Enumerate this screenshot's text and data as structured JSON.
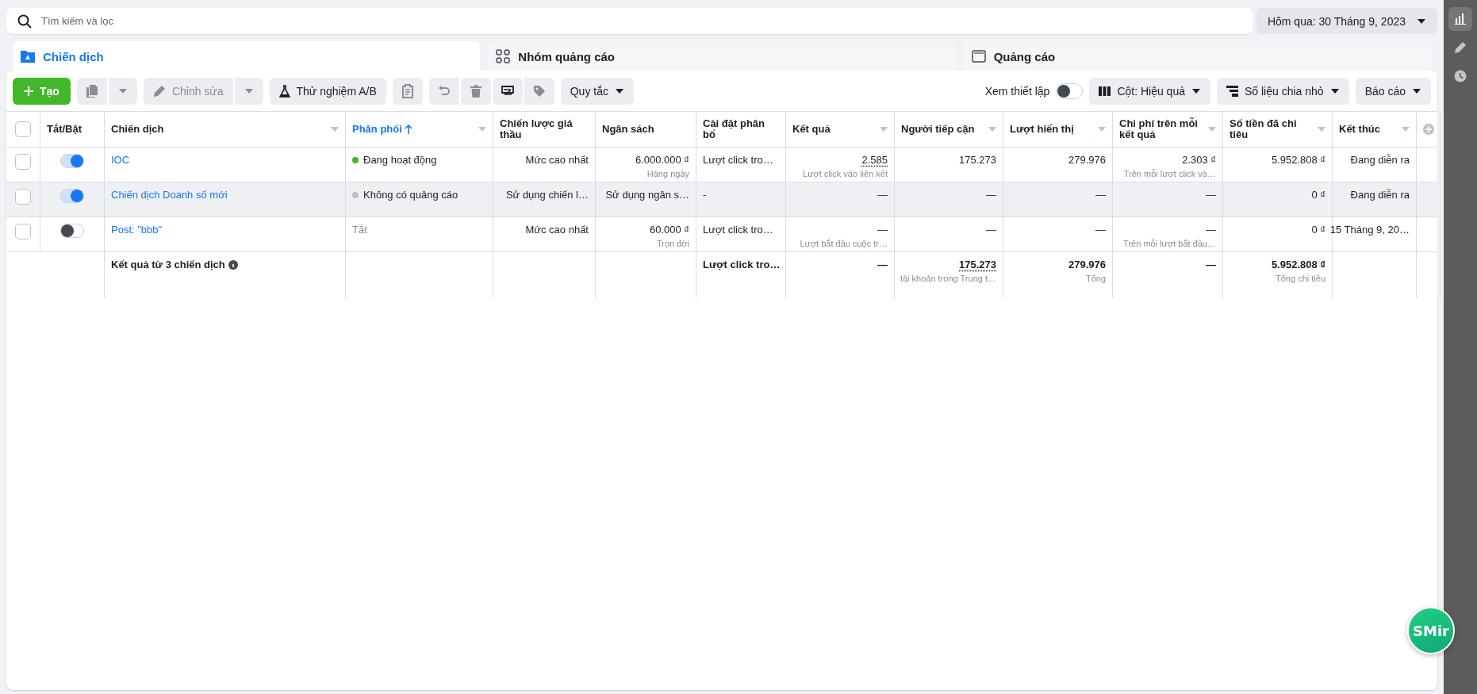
{
  "search": {
    "placeholder": "Tìm kiếm và lọc"
  },
  "date_range": {
    "label": "Hôm qua: 30 Tháng 9, 2023"
  },
  "tabs": [
    {
      "label": "Chiến dịch",
      "selected": true,
      "kind": "campaign"
    },
    {
      "label": "Nhóm quảng cáo",
      "selected": false,
      "kind": "adset"
    },
    {
      "label": "Quảng cáo",
      "selected": false,
      "kind": "ad"
    }
  ],
  "toolbar": {
    "left": [
      {
        "kind": "primary",
        "label": "Tạo",
        "disabled": false
      },
      {
        "kind": "copy",
        "disabled": true
      },
      {
        "kind": "split",
        "label": "Chỉnh sửa",
        "disabled": true
      },
      {
        "kind": "button",
        "label": "Thử nghiệm A/B",
        "disabled": false
      },
      {
        "kind": "clipboard",
        "disabled": true
      },
      {
        "kind": "undo",
        "disabled": true
      },
      {
        "kind": "trash",
        "disabled": true
      },
      {
        "kind": "swap",
        "disabled": false
      },
      {
        "kind": "tag",
        "disabled": true
      },
      {
        "kind": "dropdown",
        "label": "Quy tắc",
        "disabled": false
      }
    ],
    "view_setup": {
      "label": "Xem thiết lập",
      "on": false
    },
    "right": [
      {
        "label": "Cột: Hiệu quả"
      },
      {
        "label": "Số liệu chia nhỏ"
      },
      {
        "label": "Báo cáo"
      }
    ]
  },
  "table": {
    "select_all": {
      "checked": false
    },
    "columns": [
      {
        "label": "Tắt/Bật",
        "has_menu": false,
        "sorted": false
      },
      {
        "label": "Chiến dịch",
        "has_menu": true,
        "sorted": false
      },
      {
        "label": "Phân phối",
        "has_menu": true,
        "sorted": true
      },
      {
        "label": "Chiến lược giá thầu",
        "has_menu": false,
        "sorted": false
      },
      {
        "label": "Ngân sách",
        "has_menu": false,
        "sorted": false
      },
      {
        "label": "Cài đặt phân bổ",
        "has_menu": false,
        "sorted": false
      },
      {
        "label": "Kết quả",
        "has_menu": true,
        "sorted": false
      },
      {
        "label": "Người tiếp cận",
        "has_menu": true,
        "sorted": false
      },
      {
        "label": "Lượt hiển thị",
        "has_menu": true,
        "sorted": false
      },
      {
        "label": "Chi phí trên mỗi kết quả",
        "has_menu": true,
        "sorted": false
      },
      {
        "label": "Số tiền đã chi tiêu",
        "has_menu": true,
        "sorted": false
      },
      {
        "label": "Kết thúc",
        "has_menu": true,
        "sorted": false
      }
    ],
    "rows": [
      {
        "checked": false,
        "hovered": false,
        "cells": [
          {
            "on": true
          },
          {
            "value": "IOC"
          },
          {
            "value": "Đang hoạt động",
            "color": "#42b72a"
          },
          {
            "value": "Mức cao nhất"
          },
          {
            "value": "6.000.000 ₫",
            "note": "Hàng ngày"
          },
          {
            "value": "Lượt click tro…"
          },
          {
            "value": "2.585",
            "note": "Lượt click vào liên kết",
            "underlined": true
          },
          {
            "value": "175.273"
          },
          {
            "value": "279.976"
          },
          {
            "value": "2.303 ₫",
            "note": "Trên mỗi lượt click và…"
          },
          {
            "value": "5.952.808 ₫"
          },
          {
            "value": "Đang diễn ra"
          }
        ]
      },
      {
        "checked": false,
        "hovered": true,
        "cells": [
          {
            "on": true
          },
          {
            "value": "Chiến dịch Doanh số mới"
          },
          {
            "value": "Không có quảng cáo",
            "color": "#bcc0c4"
          },
          {
            "value": "Sử dụng chiến l…"
          },
          {
            "value": "Sử dụng ngân s…"
          },
          {
            "value": "-"
          },
          {
            "value": "—"
          },
          {
            "value": "—"
          },
          {
            "value": "—"
          },
          {
            "value": "—"
          },
          {
            "value": "0 ₫"
          },
          {
            "value": "Đang diễn ra"
          }
        ]
      },
      {
        "checked": false,
        "hovered": false,
        "cells": [
          {
            "on": false
          },
          {
            "value": "Post: \"bbb\""
          },
          {
            "value": "Tắt"
          },
          {
            "value": "Mức cao nhất"
          },
          {
            "value": "60.000 ₫",
            "note": "Trọn đời"
          },
          {
            "value": "Lượt click tro…"
          },
          {
            "value": "—",
            "note": "Lượt bắt đầu cuộc tr…"
          },
          {
            "value": "—"
          },
          {
            "value": "—"
          },
          {
            "value": "—",
            "note": "Trên mỗi lượt bắt đầu…"
          },
          {
            "value": "0 ₫"
          },
          {
            "value": "15 Tháng 9, 20…"
          }
        ]
      }
    ],
    "summary": {
      "cells": [
        null,
        {
          "value": "Kết quả từ 3 chiến dịch"
        },
        null,
        null,
        null,
        {
          "value": "Lượt click tro…"
        },
        {
          "value": "—"
        },
        {
          "value": "175.273",
          "note": "tài khoản trong Trung t…",
          "underlined": true
        },
        {
          "value": "279.976",
          "note": "Tổng"
        },
        {
          "value": "—"
        },
        {
          "value": "5.952.808 ₫",
          "note": "Tổng chi tiêu"
        },
        null
      ]
    }
  },
  "rail": {
    "items": [
      {
        "kind": "chart",
        "selected": true
      },
      {
        "kind": "edit",
        "selected": false
      },
      {
        "kind": "history",
        "selected": false
      }
    ]
  },
  "fab": {
    "label": "SMir"
  }
}
